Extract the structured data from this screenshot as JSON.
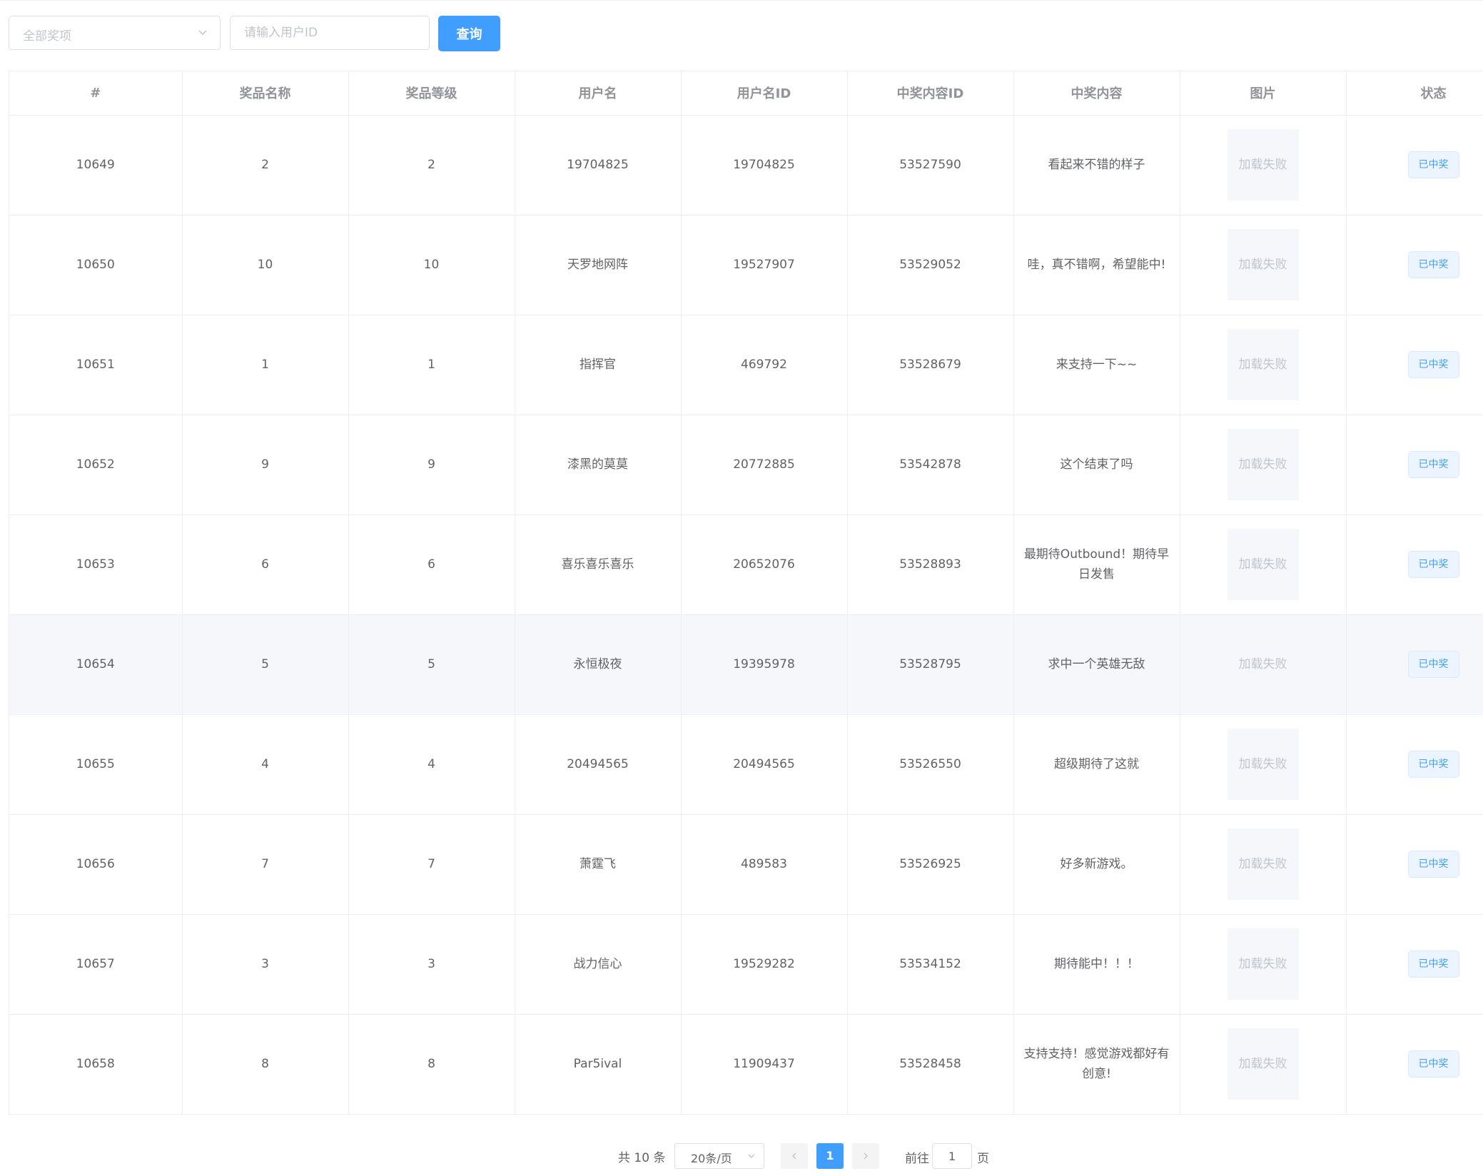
{
  "toolbar": {
    "select_placeholder": "全部奖项",
    "input_placeholder": "请输入用户ID",
    "query_label": "查询"
  },
  "table": {
    "columns": [
      "#",
      "奖品名称",
      "奖品等级",
      "用户名",
      "用户名ID",
      "中奖内容ID",
      "中奖内容",
      "图片",
      "状态"
    ],
    "image_failed": "加载失败",
    "status_label": "已中奖",
    "rows": [
      {
        "id": "10649",
        "prize_name": "2",
        "prize_level": "2",
        "username": "19704825",
        "user_id": "19704825",
        "content_id": "53527590",
        "content": "看起来不错的样子"
      },
      {
        "id": "10650",
        "prize_name": "10",
        "prize_level": "10",
        "username": "天罗地网阵",
        "user_id": "19527907",
        "content_id": "53529052",
        "content": "哇，真不错啊，希望能中!"
      },
      {
        "id": "10651",
        "prize_name": "1",
        "prize_level": "1",
        "username": "指挥官",
        "user_id": "469792",
        "content_id": "53528679",
        "content": "来支持一下~~"
      },
      {
        "id": "10652",
        "prize_name": "9",
        "prize_level": "9",
        "username": "漆黑的莫莫",
        "user_id": "20772885",
        "content_id": "53542878",
        "content": "这个结束了吗"
      },
      {
        "id": "10653",
        "prize_name": "6",
        "prize_level": "6",
        "username": "喜乐喜乐喜乐",
        "user_id": "20652076",
        "content_id": "53528893",
        "content": "最期待Outbound！期待早日发售"
      },
      {
        "id": "10654",
        "prize_name": "5",
        "prize_level": "5",
        "username": "永恒极夜",
        "user_id": "19395978",
        "content_id": "53528795",
        "content": "求中一个英雄无敌"
      },
      {
        "id": "10655",
        "prize_name": "4",
        "prize_level": "4",
        "username": "20494565",
        "user_id": "20494565",
        "content_id": "53526550",
        "content": "超级期待了这就"
      },
      {
        "id": "10656",
        "prize_name": "7",
        "prize_level": "7",
        "username": "萧霆飞",
        "user_id": "489583",
        "content_id": "53526925",
        "content": "好多新游戏。"
      },
      {
        "id": "10657",
        "prize_name": "3",
        "prize_level": "3",
        "username": "战力信心",
        "user_id": "19529282",
        "content_id": "53534152",
        "content": "期待能中！！！"
      },
      {
        "id": "10658",
        "prize_name": "8",
        "prize_level": "8",
        "username": "Par5ival",
        "user_id": "11909437",
        "content_id": "53528458",
        "content": "支持支持！感觉游戏都好有创意!"
      }
    ]
  },
  "pagination": {
    "total": "共 10 条",
    "page_size": "20条/页",
    "current_page": "1",
    "goto_label": "前往",
    "goto_value": "1",
    "page_suffix": "页"
  }
}
